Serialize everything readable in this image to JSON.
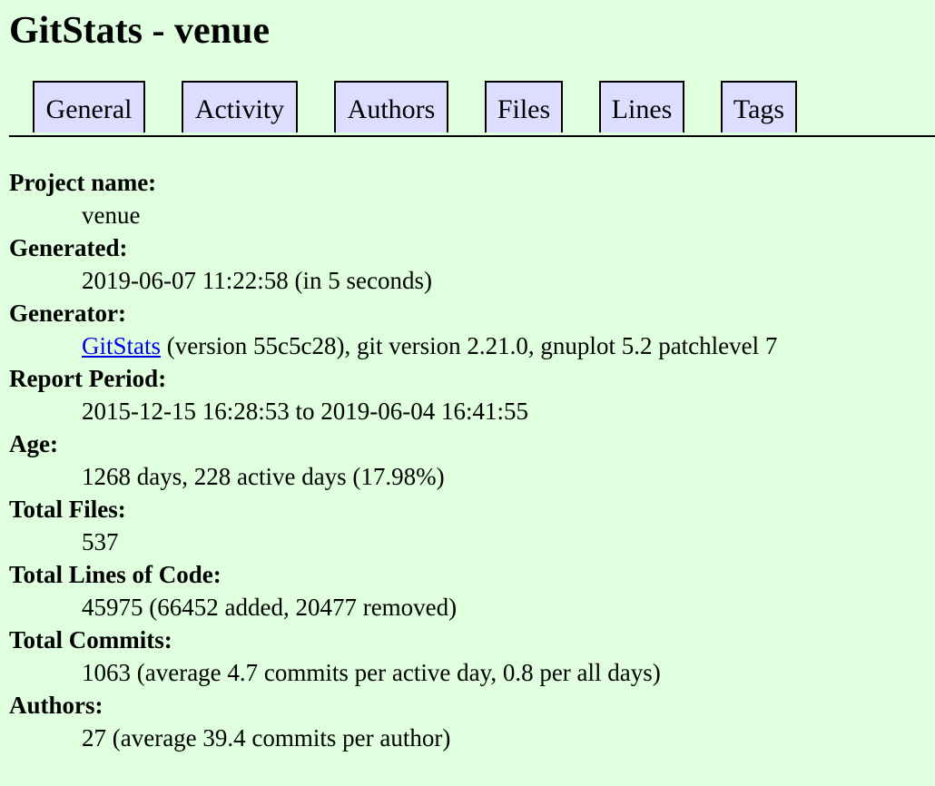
{
  "page": {
    "title": "GitStats - venue"
  },
  "nav": {
    "tabs": [
      {
        "label": "General"
      },
      {
        "label": "Activity"
      },
      {
        "label": "Authors"
      },
      {
        "label": "Files"
      },
      {
        "label": "Lines"
      },
      {
        "label": "Tags"
      }
    ]
  },
  "stats": {
    "project_name": {
      "label": "Project name:",
      "value": "venue"
    },
    "generated": {
      "label": "Generated:",
      "value": "2019-06-07 11:22:58 (in 5 seconds)"
    },
    "generator": {
      "label": "Generator:",
      "link_text": "GitStats",
      "rest": " (version 55c5c28), git version 2.21.0, gnuplot 5.2 patchlevel 7"
    },
    "report_period": {
      "label": "Report Period:",
      "value": "2015-12-15 16:28:53 to 2019-06-04 16:41:55"
    },
    "age": {
      "label": "Age:",
      "value": "1268 days, 228 active days (17.98%)"
    },
    "total_files": {
      "label": "Total Files:",
      "value": "537"
    },
    "total_lines": {
      "label": "Total Lines of Code:",
      "value": "45975 (66452 added, 20477 removed)"
    },
    "total_commits": {
      "label": "Total Commits:",
      "value": "1063 (average 4.7 commits per active day, 0.8 per all days)"
    },
    "authors": {
      "label": "Authors:",
      "value": "27 (average 39.4 commits per author)"
    }
  },
  "colors": {
    "background": "#dfffdf",
    "tab_background": "#ddddff",
    "link": "#0000ee"
  }
}
